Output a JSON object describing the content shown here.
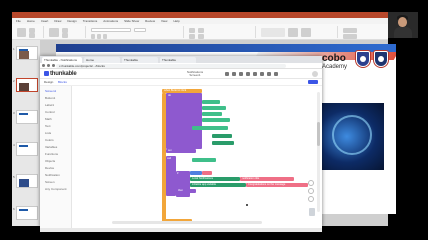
{
  "powerpoint": {
    "ribbon_tabs": [
      "File",
      "Home",
      "Insert",
      "Draw",
      "Design",
      "Transitions",
      "Animations",
      "Slide Show",
      "Review",
      "View",
      "Help"
    ]
  },
  "slides_panel": {
    "numbers": [
      "1",
      "2",
      "3",
      "4",
      "5",
      "6"
    ]
  },
  "slide": {
    "logo_main": "cobo",
    "logo_sub": "Academy"
  },
  "browser": {
    "tabs": [
      "Thunkable - Notifications",
      "Home",
      "Thunkable",
      "Thunkable"
    ],
    "address": "x.thunkable.com/projects/.../blocks"
  },
  "thunkable": {
    "logo": "thunkable",
    "project_name": "Notifications",
    "project_sub": "Screen1",
    "sub_tabs": [
      "Design",
      "Blocks"
    ],
    "sidebar_items": [
      "Screen1",
      "Button1",
      "Label1",
      "Control",
      "Math",
      "Text",
      "Lists",
      "Colors",
      "Variables",
      "Functions",
      "Objects",
      "Device",
      "Notification",
      "Screen",
      "Any Component"
    ],
    "blocks": [
      "when Button1 Click",
      "do",
      "set",
      "call",
      "initialize app variable",
      "if",
      "then",
      "Local Notifications",
      "notification title",
      "Congratulations on the message"
    ]
  }
}
